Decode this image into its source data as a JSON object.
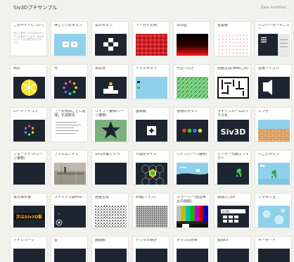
{
  "header": {
    "title": "Siv3Dプチサンプル",
    "sort_label": "Date modified ⌄"
  },
  "cards": [
    {
      "label": "このサイトについて",
      "desc": "書いて動作したSiv3Dのサンプルを集めています。Siv3Dのコードは公開されたものです。"
    },
    {
      "label": "押しているボタン"
    },
    {
      "label": "矢印ボタン"
    },
    {
      "label": "アーガイル柄"
    },
    {
      "label": "炎の壁"
    },
    {
      "label": "星模様"
    },
    {
      "label": "ハンバーガーメニュー"
    },
    {
      "label": "時計"
    },
    {
      "label": "光"
    },
    {
      "label": "表彰台"
    },
    {
      "label": "トグルボタン"
    },
    {
      "label": "七宝つなぎ"
    },
    {
      "label": "迷路生成(棒倒し法)"
    },
    {
      "label": "音量アイコン"
    },
    {
      "label": "ロードアイコン"
    },
    {
      "label": "「一定時間ごとに処理」を関数化"
    },
    {
      "label": "ワイプ・遷移(シーン遷移)"
    },
    {
      "label": "画風鏡"
    },
    {
      "label": "普通のボタン"
    },
    {
      "label": "ライトブルームのクラス化"
    },
    {
      "label": "レンガ"
    },
    {
      "label": "フェードイン(シーン遷移)"
    },
    {
      "label": "フィルムノイズ"
    },
    {
      "label": "SVGが動くやつ"
    },
    {
      "label": "六角形タイル"
    },
    {
      "label": "ワイプ(シーン遷移)"
    },
    {
      "label": "レーザー光線エフェクト"
    },
    {
      "label": "へこむボタン"
    },
    {
      "label": "電光掲示板"
    },
    {
      "label": "スティック操作UI"
    },
    {
      "label": "迷路生成"
    },
    {
      "label": "砂嵐(ノイズ)"
    },
    {
      "label": "カラーバー(放送休止の画面)"
    },
    {
      "label": "数値入力UI"
    },
    {
      "label": "シャボン玉"
    },
    {
      "label": "トイレマーク"
    },
    {
      "label": "型"
    },
    {
      "label": "画面鏡"
    },
    {
      "label": "デジタル時計"
    },
    {
      "label": "ガラスの効果"
    },
    {
      "label": "座標UI"
    },
    {
      "label": "キーボード"
    }
  ],
  "thumb_text": {
    "siv3d_logo": "Siv3D",
    "led_sign": "次はSiv3D駅",
    "number_value": "0.00"
  }
}
